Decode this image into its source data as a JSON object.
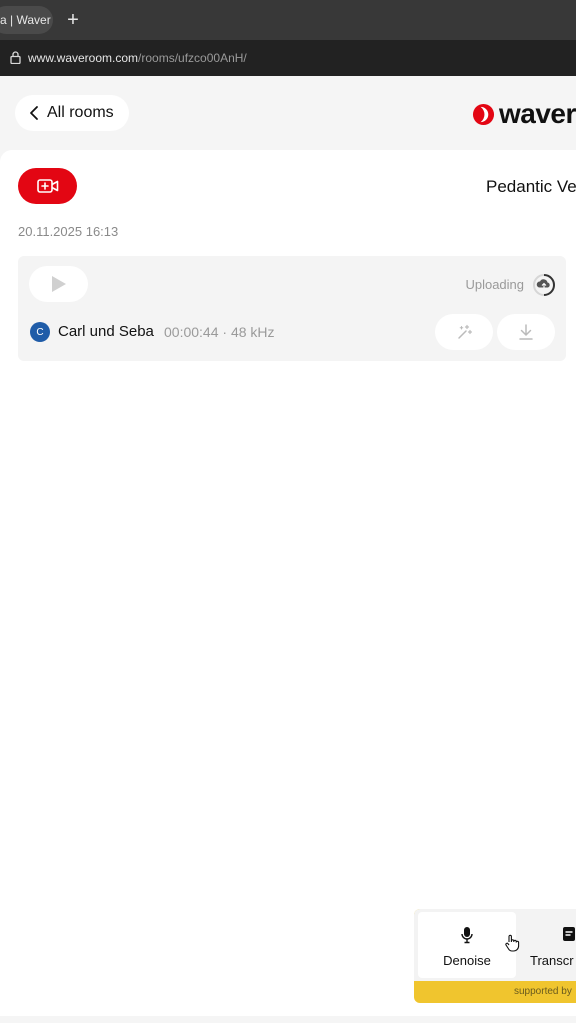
{
  "browser": {
    "tab_title": "a | Waver",
    "new_tab": "+",
    "url_domain": "www.waveroom.com",
    "url_path": "/rooms/ufzco00AnH/"
  },
  "header": {
    "back_label": "All rooms",
    "logo_text": "waver",
    "brand_color": "#e30613"
  },
  "room": {
    "title": "Pedantic Ve",
    "date": "20.11.2025 16:13",
    "record_icon": "video-add-icon"
  },
  "track": {
    "avatar_initial": "C",
    "name": "Carl und Seba",
    "meta": "00:00:44 · 48 kHz",
    "status": "Uploading",
    "status_icon": "cloud-upload-icon"
  },
  "tools": {
    "items": [
      {
        "label": "Denoise",
        "icon": "microphone-icon"
      },
      {
        "label": "Transcr",
        "icon": "transcript-icon"
      }
    ],
    "supported_by": "supported by"
  }
}
